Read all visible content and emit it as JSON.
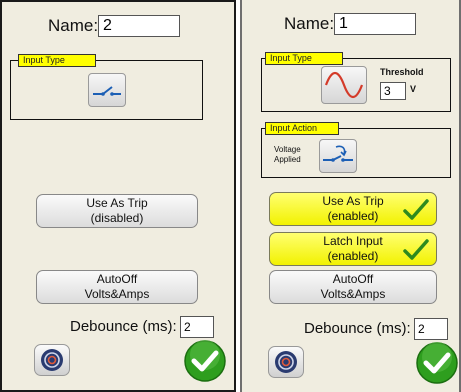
{
  "left": {
    "name_label": "Name:",
    "name_value": "2",
    "input_type_tag": "Input Type",
    "input_type_icon": "open-contact-switch-icon",
    "use_as_trip_line1": "Use As Trip",
    "use_as_trip_line2": "(disabled)",
    "autooff_line1": "AutoOff",
    "autooff_line2": "Volts&Amps",
    "debounce_label": "Debounce (ms):",
    "debounce_value": "2",
    "sound_icon": "speaker-icon",
    "ok_icon": "checkmark-icon"
  },
  "right": {
    "name_label": "Name:",
    "name_value": "1",
    "input_type_tag": "Input Type",
    "input_type_icon": "sine-wave-icon",
    "threshold_label": "Threshold",
    "threshold_value": "3",
    "threshold_unit": "V",
    "input_action_tag": "Input Action",
    "voltage_applied_line1": "Voltage",
    "voltage_applied_line2": "Applied",
    "input_action_icon": "closing-contact-switch-icon",
    "use_as_trip_line1": "Use As Trip",
    "use_as_trip_line2": "(enabled)",
    "latch_input_line1": "Latch Input",
    "latch_input_line2": "(enabled)",
    "autooff_line1": "AutoOff",
    "autooff_line2": "Volts&Amps",
    "debounce_label": "Debounce (ms):",
    "debounce_value": "2",
    "sound_icon": "speaker-icon",
    "ok_icon": "checkmark-icon"
  },
  "colors": {
    "panel_bg": "#f0ede0",
    "tag_yellow": "#ffff00",
    "enabled_yellow": "#ffff44",
    "check_green": "#2e9e1e"
  }
}
